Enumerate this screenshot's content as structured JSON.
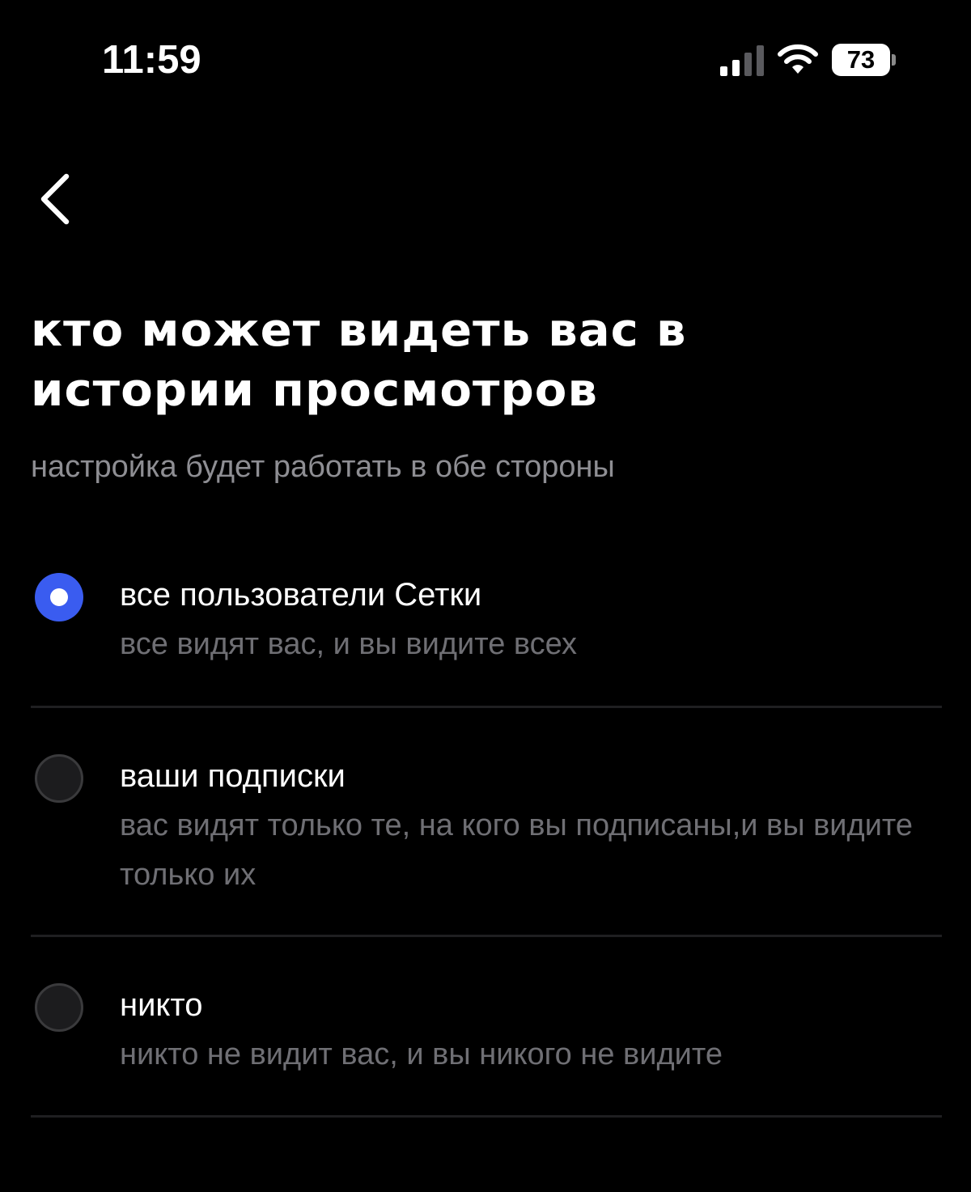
{
  "status_bar": {
    "time": "11:59",
    "battery_level": "73",
    "signal_icon": "cellular-signal-icon",
    "wifi_icon": "wifi-icon"
  },
  "navigation": {
    "back_icon": "chevron-left-icon"
  },
  "header": {
    "title": "кто может видеть вас в истории просмотров",
    "subtitle": "настройка будет работать в обе стороны"
  },
  "options": [
    {
      "title": "все пользователи Сетки",
      "description": "все видят вас, и вы видите всех",
      "selected": true
    },
    {
      "title": "ваши подписки",
      "description": "вас видят только те, на кого вы подписаны,и вы видите только их",
      "selected": false
    },
    {
      "title": "никто",
      "description": "никто не видит вас, и вы никого не видите",
      "selected": false
    }
  ],
  "colors": {
    "background": "#000000",
    "accent": "#3a5cf0",
    "secondary_text": "#8e8e93",
    "description_text": "#6f6f74"
  }
}
